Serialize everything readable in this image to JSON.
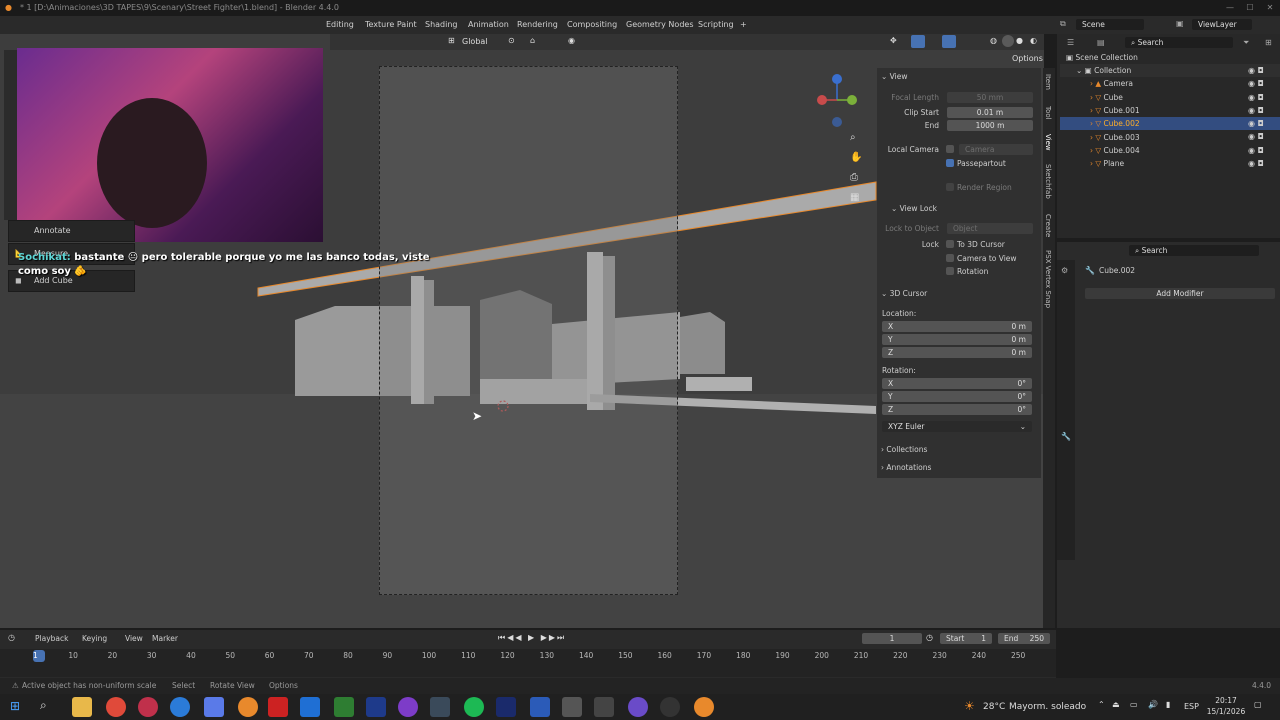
{
  "window": {
    "title": "* 1 [D:\\Animaciones\\3D TAPES\\9\\Scenary\\Street Fighter\\1.blend] - Blender 4.4.0"
  },
  "workspaces": [
    "Editing",
    "Texture Paint",
    "Shading",
    "Animation",
    "Rendering",
    "Compositing",
    "Geometry Nodes",
    "Scripting",
    "+"
  ],
  "scene": {
    "name": "Scene",
    "viewlayer": "ViewLayer"
  },
  "viewport": {
    "transform": "Global",
    "options": "Options"
  },
  "chat": {
    "user": "Sochikat:",
    "message": "bastante 😐 pero tolerable porque yo me las banco todas, viste como soy 🫵"
  },
  "toolbar": {
    "annotate": "Annotate",
    "measure": "Measure",
    "add_cube": "Add Cube"
  },
  "npanel": {
    "view_header": "View",
    "focal_label": "Focal Length",
    "focal_value": "50 mm",
    "clip_start_label": "Clip Start",
    "clip_start_value": "0.01 m",
    "end_label": "End",
    "end_value": "1000 m",
    "local_camera_label": "Local Camera",
    "local_camera_value": "Camera",
    "passepartout": "Passepartout",
    "render_region": "Render Region",
    "view_lock_header": "View Lock",
    "lock_to_object": "Lock to Object",
    "object_ph": "Object",
    "lock_label": "Lock",
    "to_3d_cursor": "To 3D Cursor",
    "camera_to_view": "Camera to View",
    "rotation_lock": "Rotation",
    "cursor_header": "3D Cursor",
    "location_label": "Location:",
    "loc_x": "X",
    "loc_x_val": "0 m",
    "loc_y": "Y",
    "loc_y_val": "0 m",
    "loc_z": "Z",
    "loc_z_val": "0 m",
    "rotation_label": "Rotation:",
    "rot_x": "X",
    "rot_x_val": "0°",
    "rot_y": "Y",
    "rot_y_val": "0°",
    "rot_z": "Z",
    "rot_z_val": "0°",
    "euler": "XYZ Euler",
    "collections": "Collections",
    "annotations": "Annotations"
  },
  "side_tabs": [
    "Item",
    "Tool",
    "View",
    "Sketchfab",
    "Create",
    "PSX Vertex Snap"
  ],
  "outliner": {
    "search_placeholder": "Search",
    "scene_collection": "Scene Collection",
    "collection": "Collection",
    "items": [
      "Camera",
      "Cube",
      "Cube.001",
      "Cube.002",
      "Cube.003",
      "Cube.004",
      "Plane"
    ]
  },
  "properties": {
    "search_placeholder": "Search",
    "object": "Cube.002",
    "add_modifier": "Add Modifier"
  },
  "timeline": {
    "playback": "Playback",
    "keying": "Keying",
    "view": "View",
    "marker": "Marker",
    "current_frame": "1",
    "start_label": "Start",
    "start": "1",
    "end_label": "End",
    "end": "250",
    "ticks": [
      "1",
      "10",
      "20",
      "30",
      "40",
      "50",
      "60",
      "70",
      "80",
      "90",
      "100",
      "110",
      "120",
      "130",
      "140",
      "150",
      "160",
      "170",
      "180",
      "190",
      "200",
      "210",
      "220",
      "230",
      "240",
      "250"
    ]
  },
  "status": {
    "warning": "Active object has non-uniform scale",
    "select": "Select",
    "rotate": "Rotate View",
    "options": "Options",
    "version": "4.4.0"
  },
  "taskbar": {
    "weather_temp": "28°C",
    "weather_desc": "Mayorm. soleado",
    "lang": "ESP",
    "time": "20:17",
    "date": "15/1/2026"
  },
  "colors": {
    "accent": "#4772b3",
    "selected_row": "#334d80",
    "orange": "#e8892c"
  }
}
